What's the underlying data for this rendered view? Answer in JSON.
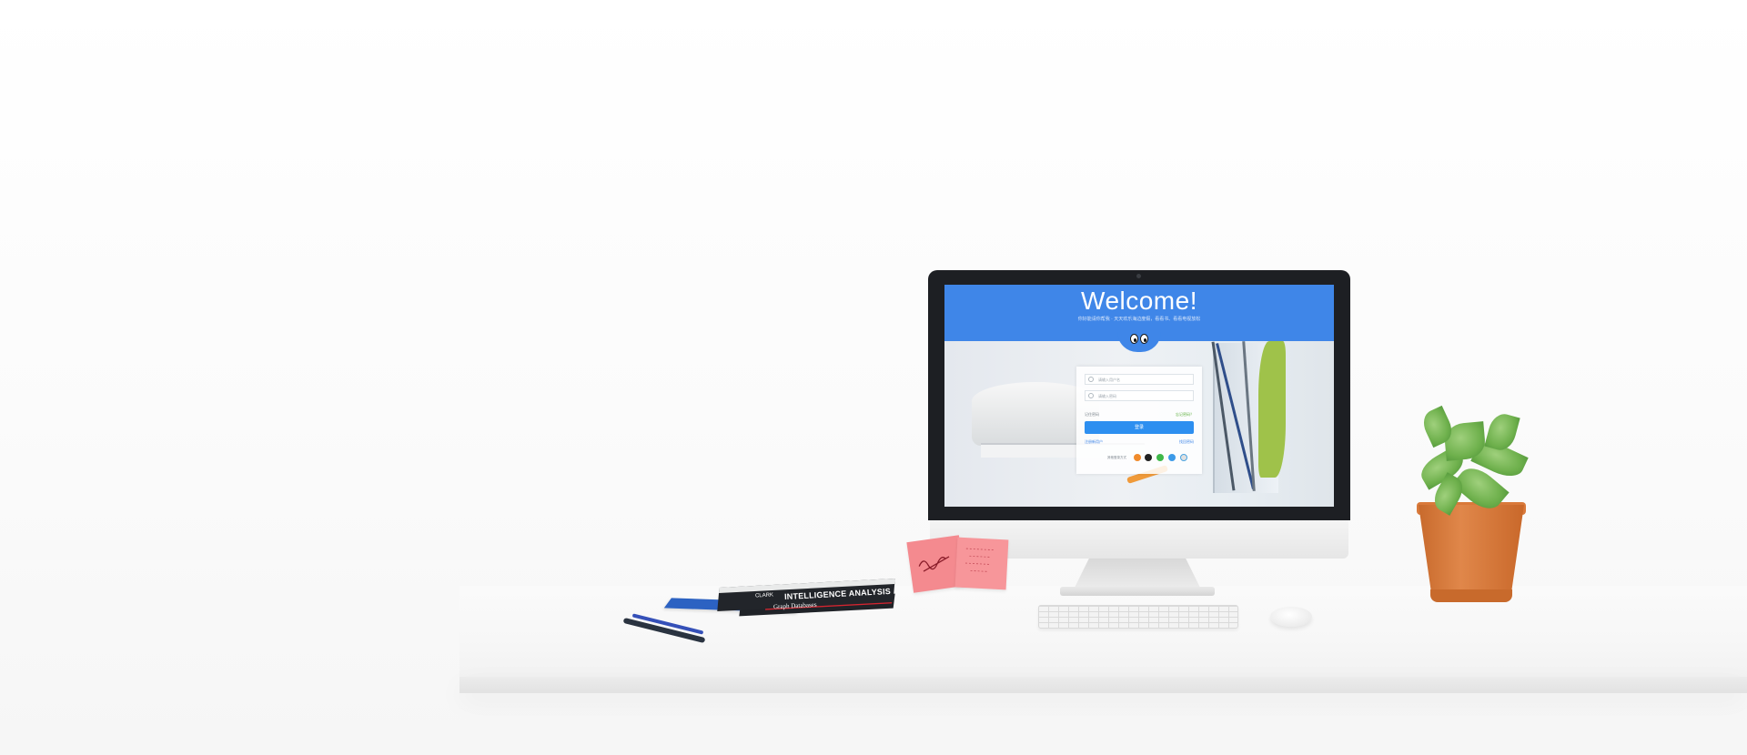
{
  "screen": {
    "welcome_title": "Welcome!",
    "subtitle": "你好能请你帮我 · 天天欢乐海边度假，看看书、看看电视放松",
    "login": {
      "username_placeholder": "请输入用户名",
      "password_placeholder": "请输入密码",
      "remember_label": "记住密码",
      "forgot_label": "忘记密码？",
      "login_button": "登录",
      "help_left": "注册新用户",
      "help_right": "找回密码",
      "other_login_label": "其他登录方式"
    }
  },
  "books": {
    "author": "CLARK",
    "title1": "INTELLIGENCE ANALYSIS",
    "title2": "Graph Databases"
  },
  "colors": {
    "header_blue": "#3f86e8",
    "button_blue": "#2d8ff0",
    "pot": "#d9793a",
    "sticky": "#f48a8f"
  }
}
